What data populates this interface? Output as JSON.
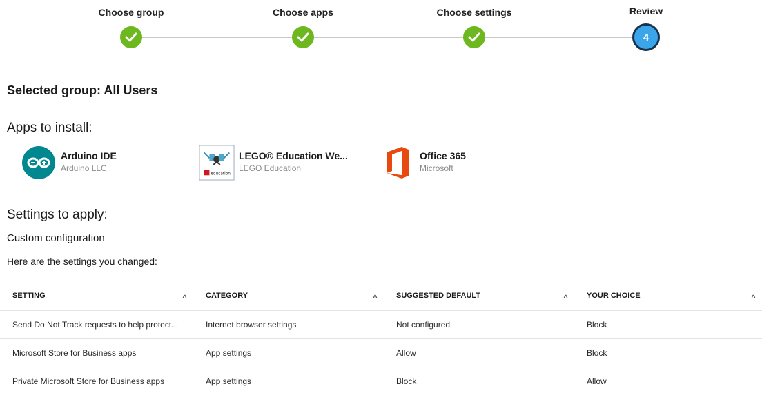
{
  "stepper": {
    "steps": [
      {
        "label": "Choose group",
        "status": "done"
      },
      {
        "label": "Choose apps",
        "status": "done"
      },
      {
        "label": "Choose settings",
        "status": "done"
      },
      {
        "label": "Review",
        "status": "current",
        "number": "4"
      }
    ],
    "done_color": "#6db81f",
    "current_color": "#3aa5e8"
  },
  "selected_group": "Selected group: All Users",
  "apps_heading": "Apps to install:",
  "apps": [
    {
      "name": "Arduino IDE",
      "publisher": "Arduino LLC",
      "icon": "arduino-icon"
    },
    {
      "name": "LEGO® Education We...",
      "publisher": "LEGO Education",
      "icon": "lego-education-icon",
      "icon_caption": "education"
    },
    {
      "name": "Office 365",
      "publisher": "Microsoft",
      "icon": "office-icon"
    }
  ],
  "settings_heading": "Settings to apply:",
  "config_type": "Custom configuration",
  "changed_note": "Here are the settings you changed:",
  "table": {
    "headers": [
      "SETTING",
      "CATEGORY",
      "SUGGESTED DEFAULT",
      "YOUR CHOICE"
    ],
    "sort_glyph": "^",
    "rows": [
      [
        "Send Do Not Track requests to help protect...",
        "Internet browser settings",
        "Not configured",
        "Block"
      ],
      [
        "Microsoft Store for Business apps",
        "App settings",
        "Allow",
        "Block"
      ],
      [
        "Private Microsoft Store for Business apps",
        "App settings",
        "Block",
        "Allow"
      ]
    ]
  }
}
